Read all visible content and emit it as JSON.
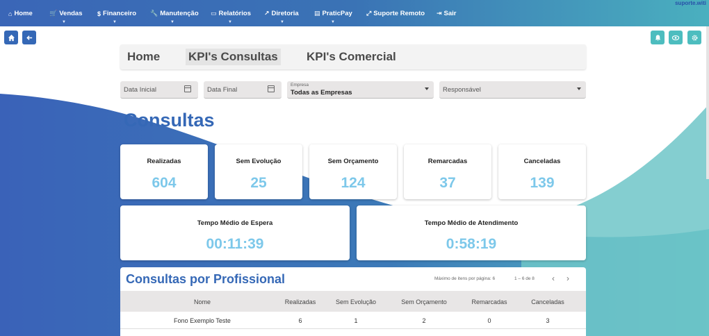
{
  "navbar": {
    "items": [
      {
        "label": "Home",
        "icon": "home-icon",
        "glyph": "⌂",
        "dropdown": false
      },
      {
        "label": "Vendas",
        "icon": "cart-icon",
        "glyph": "🛒",
        "dropdown": true
      },
      {
        "label": "Financeiro",
        "icon": "dollar-icon",
        "glyph": "$",
        "dropdown": true
      },
      {
        "label": "Manutenção",
        "icon": "wrench-icon",
        "glyph": "🔧",
        "dropdown": true
      },
      {
        "label": "Relatórios",
        "icon": "folder-icon",
        "glyph": "▭",
        "dropdown": true
      },
      {
        "label": "Diretoria",
        "icon": "line-chart-icon",
        "glyph": "↗",
        "dropdown": true
      },
      {
        "label": "PraticPay",
        "icon": "card-icon",
        "glyph": "▤",
        "dropdown": true
      },
      {
        "label": "Suporte Remoto",
        "icon": "expand-icon",
        "glyph": "⤢",
        "dropdown": false
      },
      {
        "label": "Sair",
        "icon": "logout-icon",
        "glyph": "⇥",
        "dropdown": false
      }
    ],
    "right_text": "suporte.witi"
  },
  "tabs": [
    {
      "label": "Home",
      "active": false
    },
    {
      "label": "KPI's Consultas",
      "active": true
    },
    {
      "label": "KPI's Comercial",
      "active": false
    }
  ],
  "filters": {
    "data_inicial": {
      "placeholder": "Data Inicial"
    },
    "data_final": {
      "placeholder": "Data Final"
    },
    "empresa": {
      "label": "Empresa",
      "value": "Todas as Empresas"
    },
    "responsavel": {
      "placeholder": "Responsável"
    }
  },
  "section_title": "Consultas",
  "stats": [
    {
      "label": "Realizadas",
      "value": "604"
    },
    {
      "label": "Sem Evolução",
      "value": "25"
    },
    {
      "label": "Sem Orçamento",
      "value": "124"
    },
    {
      "label": "Remarcadas",
      "value": "37"
    },
    {
      "label": "Canceladas",
      "value": "139"
    }
  ],
  "times": [
    {
      "label": "Tempo Médio de Espera",
      "value": "00:11:39"
    },
    {
      "label": "Tempo Médio de Atendimento",
      "value": "0:58:19"
    }
  ],
  "table": {
    "title": "Consultas por Profissional",
    "pager_label": "Máximo de itens por página: 6",
    "pager_range": "1 – 6 de 8",
    "prev": "‹",
    "next": "›",
    "columns": [
      "Nome",
      "Realizadas",
      "Sem Evolução",
      "Sem Orçamento",
      "Remarcadas",
      "Canceladas"
    ],
    "rows": [
      [
        "Fono Exemplo Teste",
        "6",
        "1",
        "2",
        "0",
        "3"
      ]
    ]
  },
  "colors": {
    "primary": "#3568b6",
    "accent_teal": "#4dbdbf",
    "stat_value": "#7dc8ea"
  }
}
